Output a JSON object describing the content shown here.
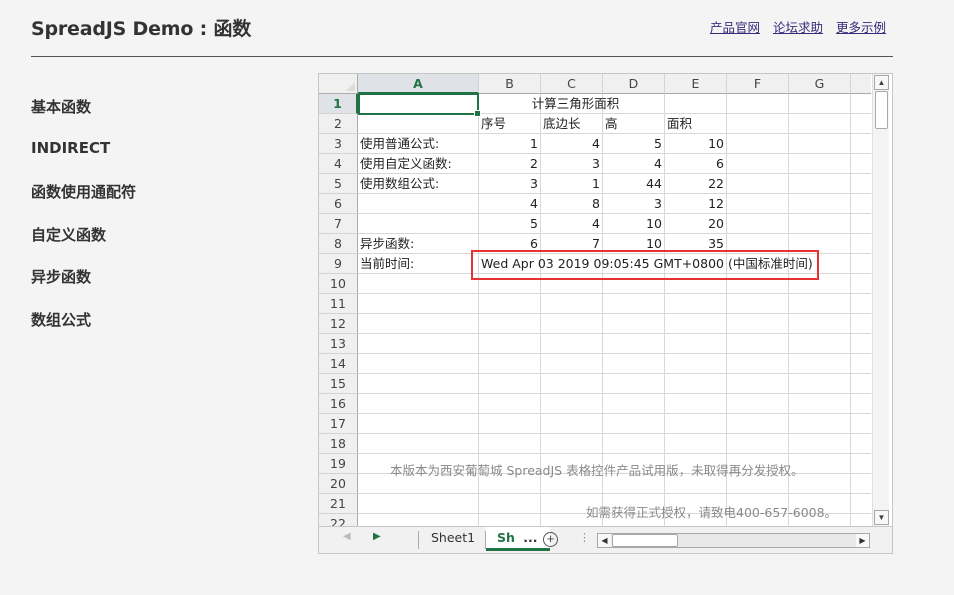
{
  "header": {
    "title": "SpreadJS Demo : 函数",
    "links": [
      "产品官网",
      "论坛求助",
      "更多示例"
    ]
  },
  "sidebar": {
    "items": [
      "基本函数",
      "INDIRECT",
      "函数使用通配符",
      "自定义函数",
      "异步函数",
      "数组公式"
    ]
  },
  "spreadsheet": {
    "columns": [
      "A",
      "B",
      "C",
      "D",
      "E",
      "F",
      "G"
    ],
    "rows": [
      "1",
      "2",
      "3",
      "4",
      "5",
      "6",
      "7",
      "8",
      "9",
      "10",
      "11",
      "12",
      "13",
      "14",
      "15",
      "16",
      "17",
      "18",
      "19",
      "20",
      "21",
      "22"
    ],
    "selected_cell": "A1",
    "cells": {
      "title": "计算三角形面积",
      "h_seq": "序号",
      "h_base": "底边长",
      "h_height": "高",
      "h_area": "面积",
      "a3": "使用普通公式:",
      "a4": "使用自定义函数:",
      "a5": "使用数组公式:",
      "a8": "异步函数:",
      "a9": "当前时间:",
      "b3": "1",
      "c3": "4",
      "d3": "5",
      "e3": "10",
      "b4": "2",
      "c4": "3",
      "d4": "4",
      "e4": "6",
      "b5": "3",
      "c5": "1",
      "d5": "44",
      "e5": "22",
      "b6": "4",
      "c6": "8",
      "d6": "3",
      "e6": "12",
      "b7": "5",
      "c7": "4",
      "d7": "10",
      "e7": "20",
      "b8": "6",
      "c8": "7",
      "d8": "10",
      "e8": "35",
      "time": "Wed Apr 03 2019 09:05:45 GMT+0800 (中国标准时间)"
    },
    "watermark_line1": "本版本为西安葡萄城 SpreadJS 表格控件产品试用版，未取得再分发授权。",
    "watermark_line2": "如需获得正式授权，请致电400-657-6008。",
    "tabs": [
      "Sheet1",
      "Sh"
    ],
    "tab_overflow": "...",
    "accent_color": "#217346",
    "highlight_color": "#e53333"
  }
}
